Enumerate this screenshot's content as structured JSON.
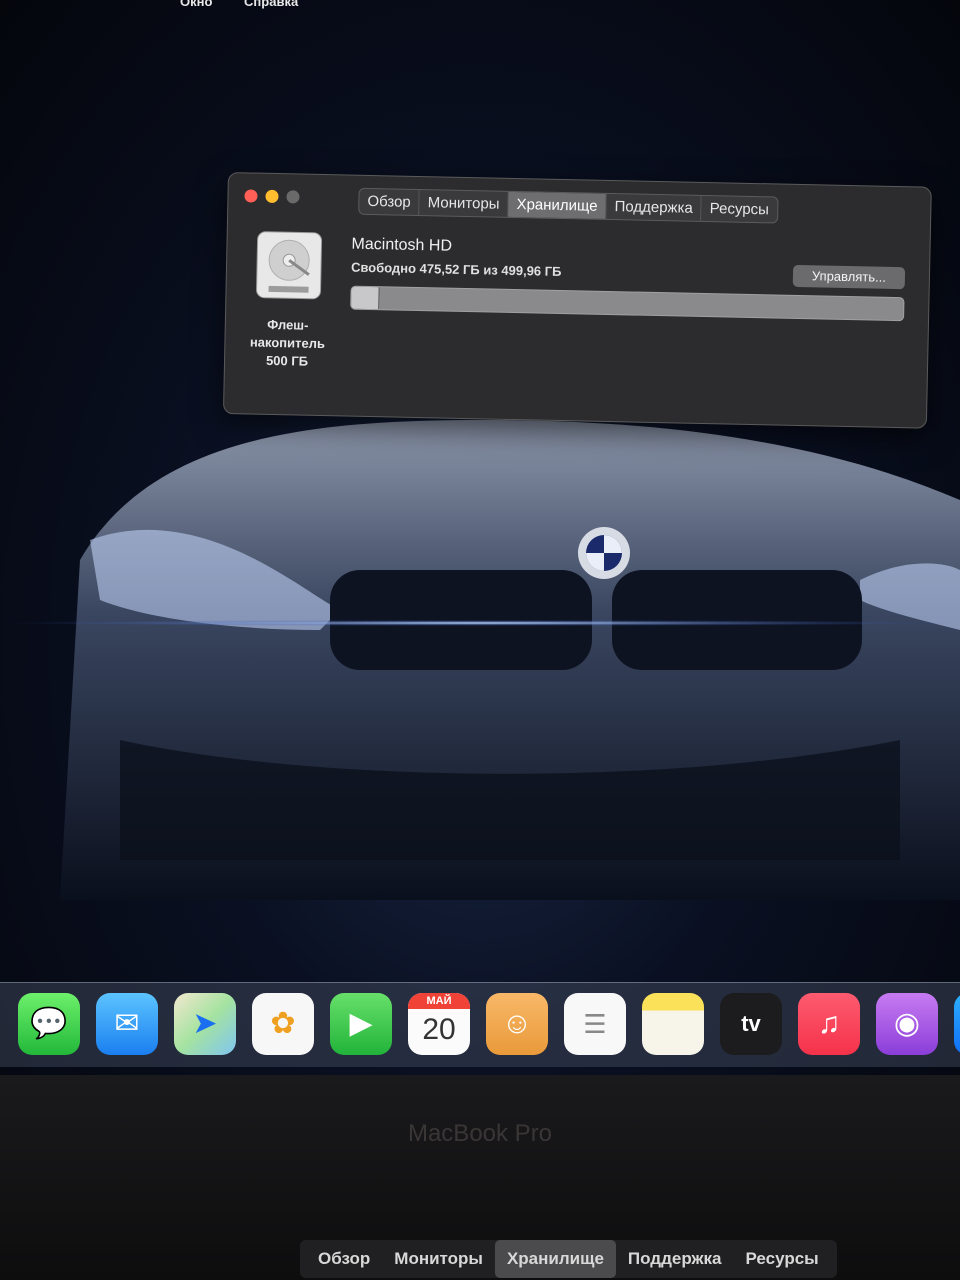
{
  "menubar": {
    "items": [
      "Окно",
      "Справка"
    ]
  },
  "window": {
    "tabs": [
      {
        "label": "Обзор",
        "active": false
      },
      {
        "label": "Мониторы",
        "active": false
      },
      {
        "label": "Хранилище",
        "active": true
      },
      {
        "label": "Поддержка",
        "active": false
      },
      {
        "label": "Ресурсы",
        "active": false
      }
    ],
    "disk": {
      "label_line1": "Флеш-",
      "label_line2": "накопитель",
      "label_line3": "500 ГБ",
      "icon": "hard-drive-icon"
    },
    "volume": {
      "name": "Macintosh HD",
      "free_text": "Свободно 475,52 ГБ из 499,96 ГБ",
      "used_fraction": 0.049
    },
    "manage_label": "Управлять..."
  },
  "dock": {
    "calendar": {
      "month": "МАЙ",
      "day": "20"
    },
    "apps": [
      "Сообщения",
      "Почта",
      "Карты",
      "Фото",
      "FaceTime",
      "Календарь",
      "Контакты",
      "Напоминания",
      "Заметки",
      "TV",
      "Музыка",
      "Подкасты",
      "App Store"
    ]
  },
  "laptop_label": "MacBook Pro",
  "touchbar": {
    "items": [
      {
        "label": "Обзор",
        "active": false
      },
      {
        "label": "Мониторы",
        "active": false
      },
      {
        "label": "Хранилище",
        "active": true
      },
      {
        "label": "Поддержка",
        "active": false
      },
      {
        "label": "Ресурсы",
        "active": false
      }
    ]
  },
  "colors": {
    "accent_red": "#ff5f57",
    "accent_yellow": "#febc2e",
    "window_bg": "#2c2c2e"
  }
}
